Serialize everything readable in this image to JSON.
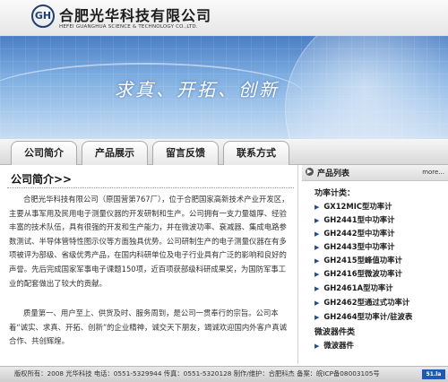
{
  "header": {
    "logo_text": "GH",
    "company_name": "合肥光华科技有限公司",
    "company_name_en": "HEFEI GUANGHUA SCIENCE & TECHNOLOGY CO.,LTD."
  },
  "banner": {
    "slogan": "求真、开拓、创新"
  },
  "nav": {
    "items": [
      "公司简介",
      "产品展示",
      "留言反馈",
      "联系方式"
    ]
  },
  "main": {
    "title": "公司简介>>",
    "paragraphs": [
      "合肥光华科技有限公司（原国营第767厂），位于合肥国家高新技术产业开发区，主要从事军用及民用电子测量仪器的开发研制和生产。公司拥有一支力量雄厚、经验丰富的技术队伍，具有很强的开发和生产能力，并在微波功率、衰减器、集成电路参数测试、半导体管特性图示仪等方面独具优势。公司研制生产的电子测量仪器在有多项被评为部级、省级优秀产品，在国内科研单位及电子行业具有广泛的影响和良好的声誉。先后完成国家军事电子课题150项，近百项获部级科研成果奖，为国防军事工业的配套做出了较大的贡献。",
      "质量第一、用户至上、供货及时、服务周到，是公司一贯奉行的宗旨。公司本着“诚实、求真、开拓、创新”的企业精神，诚交天下朋友，竭诚欢迎国内外客户真诚合作、共创辉煌。"
    ]
  },
  "sidebar": {
    "title": "产品列表",
    "more_label": "more...",
    "category_label": "功率计类：",
    "items": [
      "GX12MIC型功率计",
      "GH2441型中功率计",
      "GH2442型中功率计",
      "GH2443型中功率计",
      "GH2415型峰值功率计",
      "GH2416型微波功率计",
      "GH2461A型功率计",
      "GH2462型通过式功率计",
      "GH2464型功率计/驻波表"
    ],
    "category2_label": "微波器件类",
    "items2": [
      "微波器件"
    ]
  },
  "footer": {
    "text": "版权所有：2008 光华科技  电话：0551-5329944  传真：0551-5320128    制作/维护：合肥科杰  备案：皖ICP备08003105号",
    "badge": "51.la"
  }
}
